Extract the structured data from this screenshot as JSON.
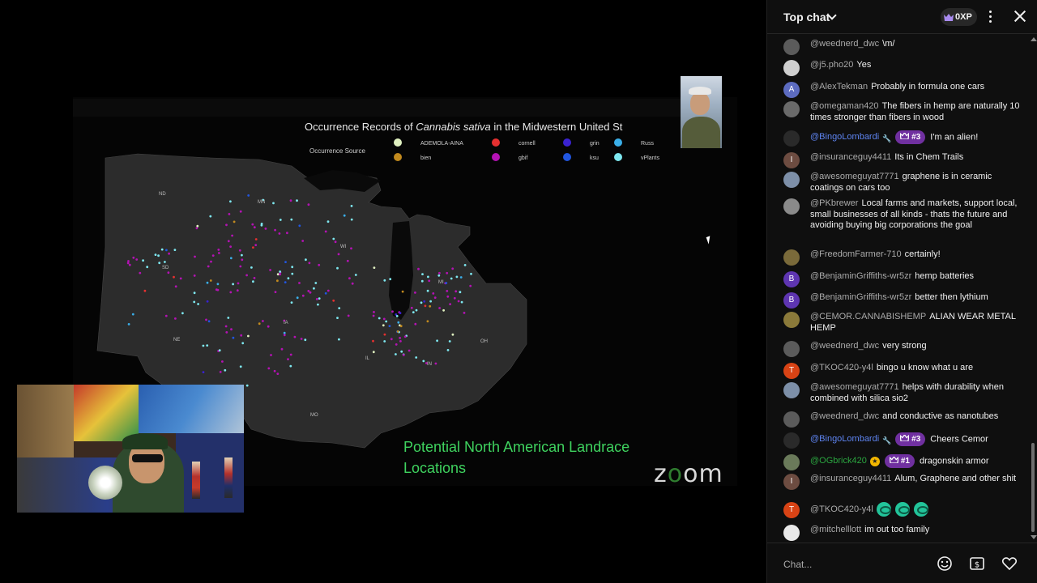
{
  "video": {
    "slide_title_prefix": "Occurrence Records of ",
    "slide_title_species": "Cannabis sativa",
    "slide_title_suffix": " in the Midwestern United St",
    "legend_title": "Occurrence Source",
    "legend": [
      {
        "label": "ADEMOLA-AINA",
        "color": "#dff0c0"
      },
      {
        "label": "cornell",
        "color": "#e53030"
      },
      {
        "label": "grin",
        "color": "#3a22d0"
      },
      {
        "label": "Russ",
        "color": "#3aaee8"
      },
      {
        "label": "bien",
        "color": "#c28a1e"
      },
      {
        "label": "gbif",
        "color": "#b412b4"
      },
      {
        "label": "ksu",
        "color": "#2156e0"
      },
      {
        "label": "vPlants",
        "color": "#7ee8f0"
      }
    ],
    "states": [
      "ND",
      "MN",
      "WI",
      "SD",
      "MI",
      "NE",
      "IA",
      "IL",
      "IN",
      "OH",
      "MO"
    ],
    "landrace_text": "Potential North American Landrace Locations",
    "zoom_logo_left": "z",
    "zoom_logo_mid": "o",
    "zoom_logo_right": "om"
  },
  "chat": {
    "title": "Top chat",
    "xp": "0XP",
    "input_placeholder": "Chat...",
    "messages": [
      {
        "author": "@weednerd_dwc",
        "text": "\\m/",
        "avatar_color": "#5b5b5b",
        "avatar_letter": ""
      },
      {
        "author": "@j5.pho20",
        "text": "Yes",
        "avatar_color": "#cfcfcf",
        "avatar_letter": ""
      },
      {
        "author": "@AlexTekman",
        "text": "Probably in formula one cars",
        "avatar_color": "#5c6bc0",
        "avatar_letter": "A"
      },
      {
        "author": "@omegaman420",
        "text": "The fibers in hemp are naturally 10 times stronger than fibers in wood",
        "avatar_color": "#6a6a6a",
        "avatar_letter": ""
      },
      {
        "author": "@BingoLombardi",
        "text": "I'm an alien!",
        "avatar_color": "#2a2a2a",
        "avatar_letter": "",
        "badge": "#3",
        "mod": true
      },
      {
        "author": "@insuranceguy4411",
        "text": "Its in Chem Trails",
        "avatar_color": "#6d4c41",
        "avatar_letter": "I"
      },
      {
        "author": "@awesomeguyat7771",
        "text": "graphene is in ceramic coatings on cars too",
        "avatar_color": "#7d8fa8",
        "avatar_letter": ""
      },
      {
        "author": "@PKbrewer",
        "text": "Local farms and markets, support local, small businesses of all kinds - thats the future and avoiding buying big corporations the goal",
        "avatar_color": "#8a8a8a",
        "avatar_letter": ""
      },
      {
        "author": "@FreedomFarmer-710",
        "text": "certainly!",
        "avatar_color": "#7a6a3a",
        "avatar_letter": ""
      },
      {
        "author": "@BenjaminGriffiths-wr5zr",
        "text": "hemp batteries",
        "avatar_color": "#5e35b1",
        "avatar_letter": "B"
      },
      {
        "author": "@BenjaminGriffiths-wr5zr",
        "text": "better then lythium",
        "avatar_color": "#5e35b1",
        "avatar_letter": "B"
      },
      {
        "author": "@CEMOR.CANNABISHEMP",
        "text": "ALIAN WEAR METAL HEMP",
        "avatar_color": "#8b7a3a",
        "avatar_letter": ""
      },
      {
        "author": "@weednerd_dwc",
        "text": "very strong",
        "avatar_color": "#5b5b5b",
        "avatar_letter": ""
      },
      {
        "author": "@TKOC420-y4l",
        "text": "bingo u know what u are",
        "avatar_color": "#d84315",
        "avatar_letter": "T"
      },
      {
        "author": "@awesomeguyat7771",
        "text": "helps with durability when combined with silica sio2",
        "avatar_color": "#7d8fa8",
        "avatar_letter": ""
      },
      {
        "author": "@weednerd_dwc",
        "text": "and conductive as nanotubes",
        "avatar_color": "#5b5b5b",
        "avatar_letter": ""
      },
      {
        "author": "@BingoLombardi",
        "text": "Cheers Cemor",
        "avatar_color": "#2a2a2a",
        "avatar_letter": "",
        "badge": "#3",
        "mod": true
      },
      {
        "author": "@OGbrick420",
        "text": "dragonskin armor",
        "avatar_color": "#6a7a5a",
        "avatar_letter": "",
        "badge": "#1",
        "green": true
      },
      {
        "author": "@insuranceguy4411",
        "text": "Alum, Graphene and other shit",
        "avatar_color": "#6d4c41",
        "avatar_letter": "I"
      },
      {
        "author": "@TKOC420-y4l",
        "text": "",
        "avatar_color": "#d84315",
        "avatar_letter": "T",
        "emojis": 3
      },
      {
        "author": "@mitchelllott",
        "text": "im out too family",
        "avatar_color": "#e8e8e8",
        "avatar_letter": ""
      }
    ]
  }
}
